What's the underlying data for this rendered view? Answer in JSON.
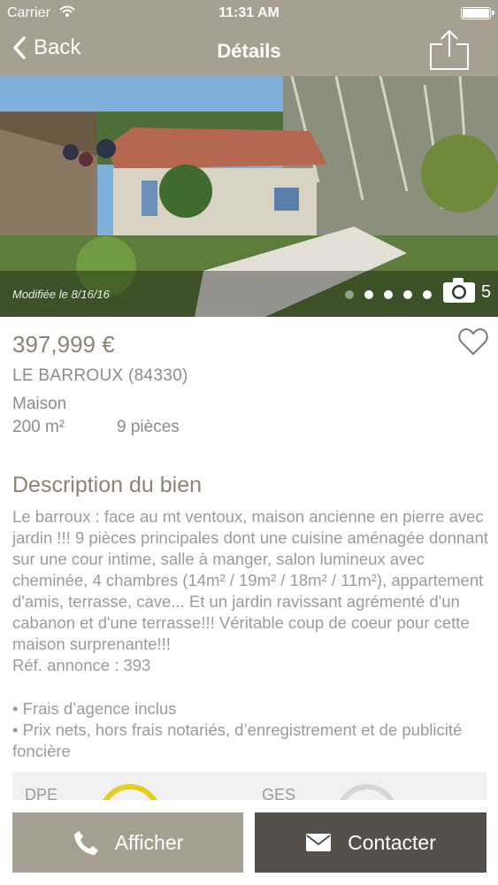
{
  "status_bar": {
    "carrier": "Carrier",
    "time": "11:31 AM"
  },
  "nav": {
    "back_label": "Back",
    "title": "Détails"
  },
  "photo": {
    "modified": "Modifiée le 8/16/16",
    "photo_count": "5",
    "active_index": 0,
    "dots": 5
  },
  "listing": {
    "price": "397,999 €",
    "location": "LE BARROUX (84330)",
    "type": "Maison",
    "surface": "200 m²",
    "rooms": "9 pièces"
  },
  "description": {
    "title": "Description du bien",
    "text": "Le barroux : face au mt ventoux, maison ancienne en pierre avec jardin !!! 9 pièces principales dont une cuisine aménagée donnant sur une cour intime, salle à manger, salon lumineux avec cheminée, 4 chambres (14m² / 19m² / 18m² / 11m²), appartement d'amis, terrasse, cave... Et un jardin ravissant agrémenté d'un cabanon et d'une terrasse!!! Véritable coup de coeur pour cette maison surprenante!!!",
    "reference": "Réf. annonce : 393"
  },
  "features": [
    "• Frais d’agence inclus",
    "• Prix nets, hors frais notariés, d’enregistrement et de publicité foncière"
  ],
  "energy": {
    "dpe_label": "DPE",
    "ges_label": "GES"
  },
  "actions": {
    "afficher": "Afficher",
    "contacter": "Contacter"
  },
  "colors": {
    "bar": "#a79f91",
    "dark_button": "#55504a",
    "price": "#8c8472",
    "dpe_gauge": "#e4cf1c"
  }
}
